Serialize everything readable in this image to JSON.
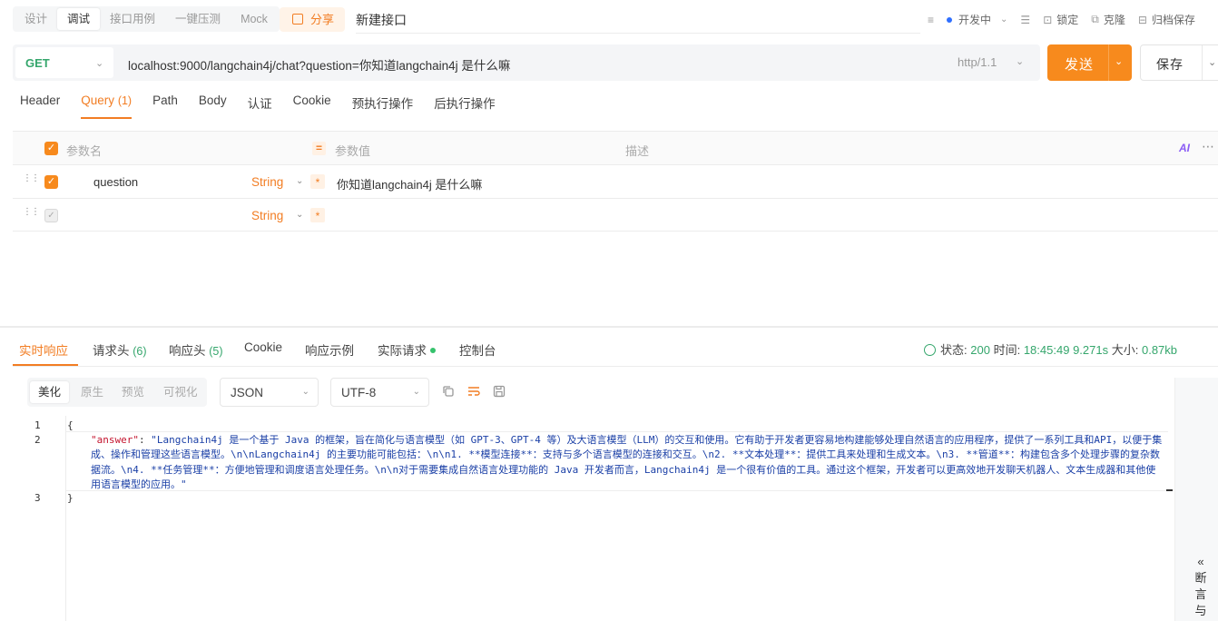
{
  "modes": [
    "设计",
    "调试",
    "接口用例",
    "一键压测",
    "Mock"
  ],
  "share_label": "分享",
  "api_name": "新建接口",
  "top_right": {
    "env": "开发中",
    "lock": "锁定",
    "clone": "克隆",
    "archive": "归档保存"
  },
  "url_bar": {
    "method": "GET",
    "url": "localhost:9000/langchain4j/chat?question=你知道langchain4j 是什么嘛",
    "http_version": "http/1.1"
  },
  "send_label": "发送",
  "save_label": "保存",
  "request_tabs": [
    {
      "label": "Header",
      "count": ""
    },
    {
      "label": "Query",
      "count": "(1)"
    },
    {
      "label": "Path",
      "count": ""
    },
    {
      "label": "Body",
      "count": ""
    },
    {
      "label": "认证",
      "count": ""
    },
    {
      "label": "Cookie",
      "count": ""
    },
    {
      "label": "预执行操作",
      "count": ""
    },
    {
      "label": "后执行操作",
      "count": ""
    }
  ],
  "params": {
    "header": {
      "name": "参数名",
      "value": "参数值",
      "desc": "描述"
    },
    "rows": [
      {
        "name": "question",
        "type": "String",
        "value": "你知道langchain4j 是什么嘛"
      },
      {
        "name": "",
        "type": "String",
        "value": ""
      }
    ],
    "ai_label": "AI"
  },
  "response_tabs": [
    {
      "label": "实时响应",
      "count": ""
    },
    {
      "label": "请求头",
      "count": "(6)"
    },
    {
      "label": "响应头",
      "count": "(5)"
    },
    {
      "label": "Cookie",
      "count": ""
    },
    {
      "label": "响应示例",
      "count": ""
    },
    {
      "label": "实际请求",
      "count": ""
    },
    {
      "label": "控制台",
      "count": ""
    }
  ],
  "status": {
    "status_label": "状态:",
    "status_value": "200",
    "time_label": "时间:",
    "time_value": "18:45:49",
    "duration": "9.271s",
    "size_label": "大小:",
    "size_value": "0.87kb"
  },
  "view_modes": [
    "美化",
    "原生",
    "预览",
    "可视化"
  ],
  "format_select": "JSON",
  "encoding_select": "UTF-8",
  "code": {
    "line_numbers": [
      "1",
      "2",
      "3"
    ],
    "open_brace": "{",
    "close_brace": "}",
    "key": "\"answer\"",
    "colon": ": ",
    "value": "\"Langchain4j 是一个基于 Java 的框架，旨在简化与语言模型（如 GPT-3、GPT-4 等）及大语言模型（LLM）的交互和使用。它有助于开发者更容易地构建能够处理自然语言的应用程序，提供了一系列工具和API，以便于集成、操作和管理这些语言模型。\\n\\nLangchain4j 的主要功能可能包括：\\n\\n1. **模型连接**：支持与多个语言模型的连接和交互。\\n2. **文本处理**：提供工具来处理和生成文本。\\n3. **管道**：构建包含多个处理步骤的复杂数据流。\\n4. **任务管理**：方便地管理和调度语言处理任务。\\n\\n对于需要集成自然语言处理功能的 Java 开发者而言，Langchain4j 是一个很有价值的工具。通过这个框架，开发者可以更高效地开发聊天机器人、文本生成器和其他使用语言模型的应用。\""
  },
  "side_panel_label": "断言与"
}
